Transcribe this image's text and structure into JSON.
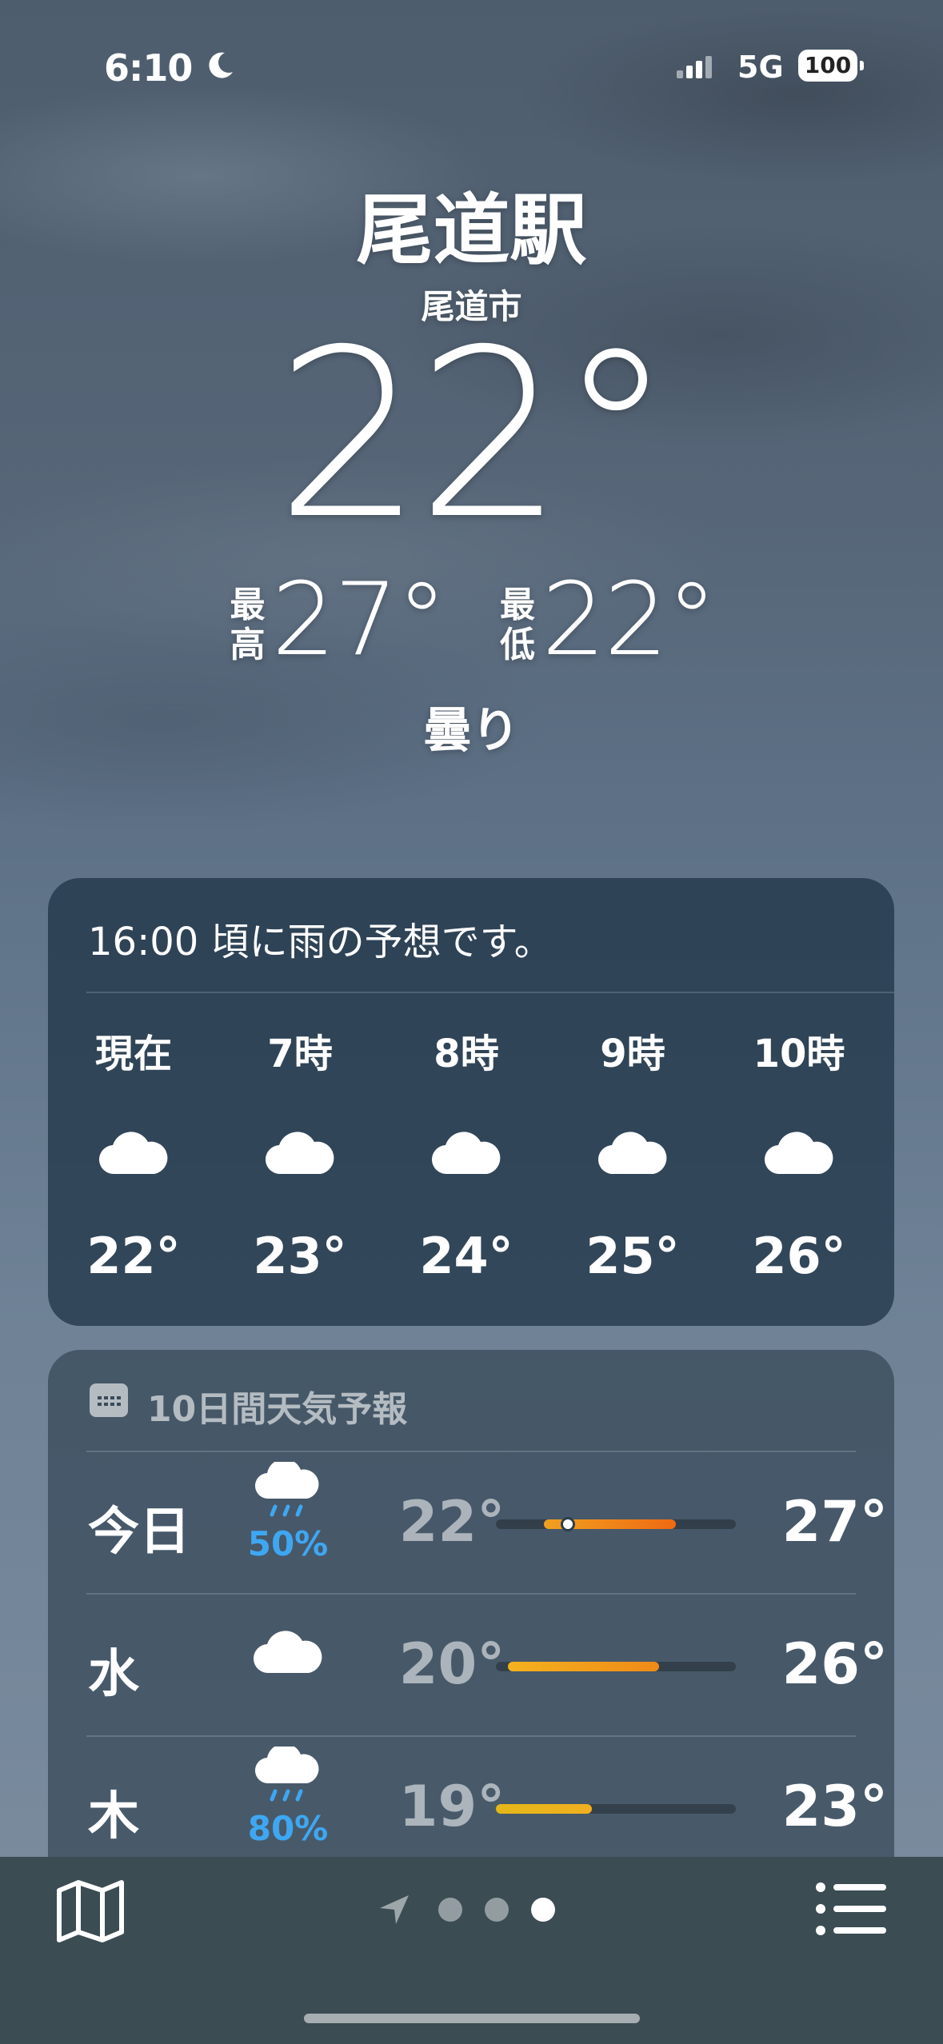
{
  "status": {
    "time": "6:10",
    "network": "5G",
    "battery": "100"
  },
  "header": {
    "location": "尾道駅",
    "city": "尾道市",
    "temperature": "22°",
    "high_label": "最高",
    "high_value": "27°",
    "low_label": "最低",
    "low_value": "22°",
    "condition": "曇り"
  },
  "hourly": {
    "summary": "16:00 頃に雨の予想です。",
    "items": [
      {
        "label": "現在",
        "temp": "22°",
        "icon": "cloud-icon"
      },
      {
        "label": "7時",
        "temp": "23°",
        "icon": "cloud-icon"
      },
      {
        "label": "8時",
        "temp": "24°",
        "icon": "cloud-icon"
      },
      {
        "label": "9時",
        "temp": "25°",
        "icon": "cloud-icon"
      },
      {
        "label": "10時",
        "temp": "26°",
        "icon": "cloud-icon"
      }
    ]
  },
  "forecast": {
    "title": "10日間天気予報",
    "days": [
      {
        "day": "今日",
        "icon": "cloud-rain-icon",
        "precip": "50%",
        "low": "22°",
        "high": "27°",
        "range_start": 0.2,
        "range_end": 0.75,
        "current": 0.3
      },
      {
        "day": "水",
        "icon": "cloud-icon",
        "precip": "",
        "low": "20°",
        "high": "26°",
        "range_start": 0.05,
        "range_end": 0.68
      },
      {
        "day": "木",
        "icon": "cloud-rain-icon",
        "precip": "80%",
        "low": "19°",
        "high": "23°",
        "range_start": 0.0,
        "range_end": 0.4
      }
    ]
  },
  "tabbar": {
    "page_count": 3,
    "active_page": 2
  }
}
